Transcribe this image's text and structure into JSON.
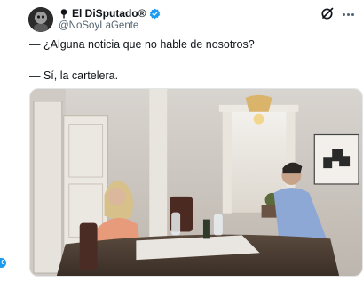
{
  "account": {
    "display_name": "El DiSputado®",
    "handle": "@NoSoyLaGente",
    "verified": true,
    "pinned": true
  },
  "post": {
    "lines": [
      "— ¿Alguna noticia que no hable de nosotros?",
      "— Sí, la cartelera."
    ]
  },
  "icons": {
    "avatar": "avatar-photo",
    "verified": "verified-badge-icon",
    "grok": "grok-icon",
    "more": "more-options-icon"
  },
  "colors": {
    "verified": "#1d9bf0",
    "text": "#0f1419",
    "secondary": "#536471"
  },
  "side_badge": {
    "label": "0"
  }
}
